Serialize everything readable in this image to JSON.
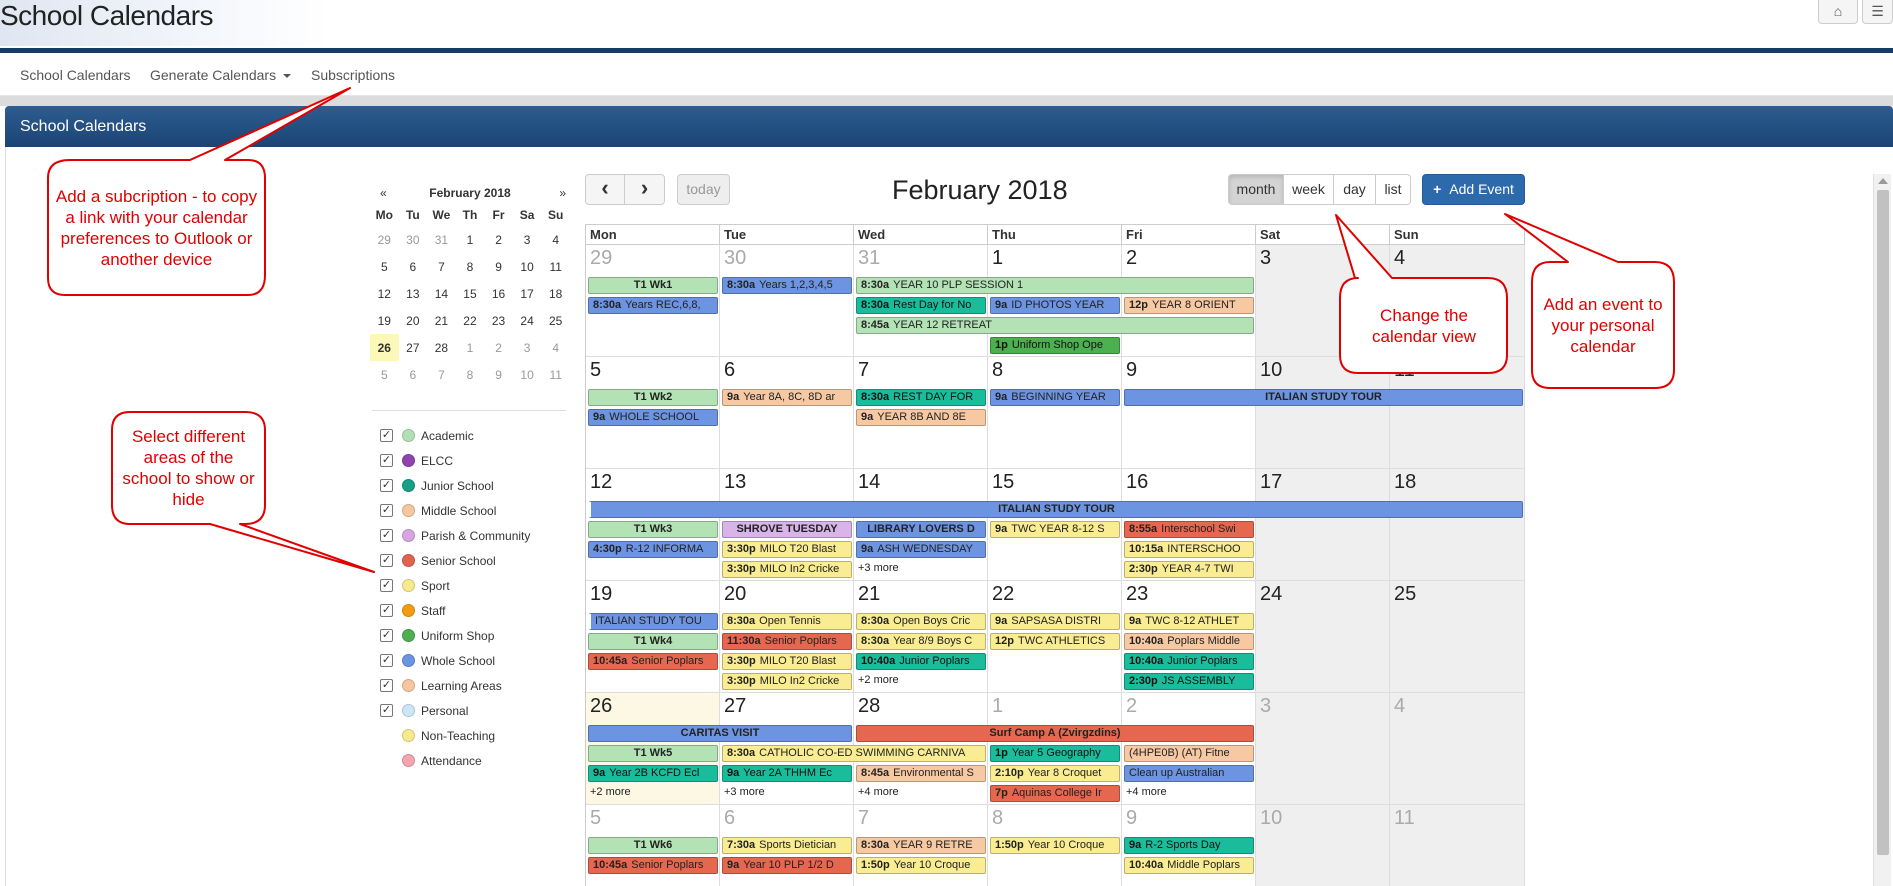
{
  "app": {
    "title": "School Calendars"
  },
  "topbar": {
    "home_icon": "home-icon",
    "menu_icon": "menu-icon"
  },
  "nav": {
    "items": [
      "School Calendars",
      "Generate Calendars",
      "Subscriptions"
    ]
  },
  "panel": {
    "title": "School Calendars"
  },
  "mini_calendar": {
    "prev": "«",
    "next": "»",
    "title": "February 2018",
    "weekdays": [
      "Mo",
      "Tu",
      "We",
      "Th",
      "Fr",
      "Sa",
      "Su"
    ],
    "weeks": [
      [
        "29",
        "30",
        "31",
        "1",
        "2",
        "3",
        "4"
      ],
      [
        "5",
        "6",
        "7",
        "8",
        "9",
        "10",
        "11"
      ],
      [
        "12",
        "13",
        "14",
        "15",
        "16",
        "17",
        "18"
      ],
      [
        "19",
        "20",
        "21",
        "22",
        "23",
        "24",
        "25"
      ],
      [
        "26",
        "27",
        "28",
        "1",
        "2",
        "3",
        "4"
      ],
      [
        "5",
        "6",
        "7",
        "8",
        "9",
        "10",
        "11"
      ]
    ],
    "today": "26"
  },
  "filters": [
    {
      "label": "Academic",
      "color": "#b3e0b3",
      "checked": true
    },
    {
      "label": "ELCC",
      "color": "#8e44ad",
      "checked": true
    },
    {
      "label": "Junior School",
      "color": "#16a085",
      "checked": true
    },
    {
      "label": "Middle School",
      "color": "#f5c6a0",
      "checked": true
    },
    {
      "label": "Parish & Community",
      "color": "#d7a6e0",
      "checked": true
    },
    {
      "label": "Senior School",
      "color": "#e0624f",
      "checked": true
    },
    {
      "label": "Sport",
      "color": "#f7e98e",
      "checked": true
    },
    {
      "label": "Staff",
      "color": "#f39c12",
      "checked": true
    },
    {
      "label": "Uniform Shop",
      "color": "#4caf50",
      "checked": true
    },
    {
      "label": "Whole School",
      "color": "#6d94e0",
      "checked": true
    },
    {
      "label": "Learning Areas",
      "color": "#f5c6a0",
      "checked": true
    },
    {
      "label": "Personal",
      "color": "#cde6f7",
      "checked": true
    },
    {
      "label": "Non-Teaching",
      "color": "#f7e98e",
      "checked": false
    },
    {
      "label": "Attendance",
      "color": "#f4a6b0",
      "checked": false
    }
  ],
  "toolbar": {
    "prev": "‹",
    "next": "›",
    "today": "today",
    "title": "February 2018",
    "views": [
      "month",
      "week",
      "day",
      "list"
    ],
    "active_view": "month",
    "add_event": "Add Event",
    "add_icon": "+"
  },
  "colors": {
    "academic": "#b3e3b5",
    "whole": "#6d94e0",
    "junior": "#1abc9c",
    "middle": "#f7c9a3",
    "sport": "#f9ec92",
    "senior": "#e5674f",
    "parish": "#d8b4e8",
    "uniform": "#4caf50",
    "learning": "#f7c9a3",
    "personal": "#cfe7f9"
  },
  "calendar": {
    "days": [
      "Mon",
      "Tue",
      "Wed",
      "Thu",
      "Fri",
      "Sat",
      "Sun"
    ],
    "weeks": [
      {
        "dates": [
          [
            "29",
            true
          ],
          [
            "30",
            true
          ],
          [
            "31",
            true
          ],
          [
            "1",
            false
          ],
          [
            "2",
            false
          ],
          [
            "3",
            false
          ],
          [
            "4",
            false
          ]
        ],
        "events": [
          {
            "c": 0,
            "s": 1,
            "r": 0,
            "cat": "academic",
            "time": "",
            "title": "T1 Wk1",
            "center": true
          },
          {
            "c": 0,
            "s": 1,
            "r": 1,
            "cat": "whole",
            "time": "8:30a",
            "title": "Years REC,6,8,"
          },
          {
            "c": 1,
            "s": 1,
            "r": 0,
            "cat": "whole",
            "time": "8:30a",
            "title": "Years 1,2,3,4,5"
          },
          {
            "c": 2,
            "s": 3,
            "r": 0,
            "cat": "academic",
            "time": "8:30a",
            "title": "YEAR 10 PLP SESSION 1"
          },
          {
            "c": 2,
            "s": 1,
            "r": 1,
            "cat": "junior",
            "time": "8:30a",
            "title": "Rest Day for No"
          },
          {
            "c": 3,
            "s": 1,
            "r": 1,
            "cat": "whole",
            "time": "9a",
            "title": "ID PHOTOS YEAR"
          },
          {
            "c": 4,
            "s": 1,
            "r": 1,
            "cat": "middle",
            "time": "12p",
            "title": "YEAR 8 ORIENT"
          },
          {
            "c": 2,
            "s": 3,
            "r": 2,
            "cat": "academic",
            "time": "8:45a",
            "title": "YEAR 12 RETREAT"
          },
          {
            "c": 3,
            "s": 1,
            "r": 3,
            "cat": "uniform",
            "time": "1p",
            "title": "Uniform Shop Ope"
          }
        ],
        "more": []
      },
      {
        "dates": [
          [
            "5",
            false
          ],
          [
            "6",
            false
          ],
          [
            "7",
            false
          ],
          [
            "8",
            false
          ],
          [
            "9",
            false
          ],
          [
            "10",
            false
          ],
          [
            "11",
            false
          ]
        ],
        "events": [
          {
            "c": 0,
            "s": 1,
            "r": 0,
            "cat": "academic",
            "time": "",
            "title": "T1 Wk2",
            "center": true
          },
          {
            "c": 0,
            "s": 1,
            "r": 1,
            "cat": "whole",
            "time": "9a",
            "title": "WHOLE SCHOOL"
          },
          {
            "c": 1,
            "s": 1,
            "r": 0,
            "cat": "middle",
            "time": "9a",
            "title": "Year 8A, 8C, 8D ar"
          },
          {
            "c": 2,
            "s": 1,
            "r": 0,
            "cat": "junior",
            "time": "8:30a",
            "title": "REST DAY FOR"
          },
          {
            "c": 2,
            "s": 1,
            "r": 1,
            "cat": "middle",
            "time": "9a",
            "title": "YEAR 8B AND 8E"
          },
          {
            "c": 3,
            "s": 1,
            "r": 0,
            "cat": "whole",
            "time": "9a",
            "title": "BEGINNING YEAR"
          },
          {
            "c": 4,
            "s": 3,
            "r": 0,
            "cat": "whole",
            "time": "",
            "title": "ITALIAN STUDY TOUR",
            "center": true,
            "contR": true
          }
        ],
        "more": []
      },
      {
        "dates": [
          [
            "12",
            false
          ],
          [
            "13",
            false
          ],
          [
            "14",
            false
          ],
          [
            "15",
            false
          ],
          [
            "16",
            false
          ],
          [
            "17",
            false
          ],
          [
            "18",
            false
          ]
        ],
        "events": [
          {
            "c": 0,
            "s": 7,
            "r": 0,
            "cat": "whole",
            "time": "",
            "title": "ITALIAN STUDY TOUR",
            "center": true,
            "contL": true
          },
          {
            "c": 0,
            "s": 1,
            "r": 1,
            "cat": "academic",
            "time": "",
            "title": "T1 Wk3",
            "center": true
          },
          {
            "c": 0,
            "s": 1,
            "r": 2,
            "cat": "whole",
            "time": "4:30p",
            "title": "R-12 INFORMA"
          },
          {
            "c": 1,
            "s": 1,
            "r": 1,
            "cat": "parish",
            "time": "",
            "title": "SHROVE TUESDAY",
            "center": true
          },
          {
            "c": 1,
            "s": 1,
            "r": 2,
            "cat": "sport",
            "time": "3:30p",
            "title": "MILO T20 Blast"
          },
          {
            "c": 1,
            "s": 1,
            "r": 3,
            "cat": "sport",
            "time": "3:30p",
            "title": "MILO In2 Cricke"
          },
          {
            "c": 2,
            "s": 1,
            "r": 1,
            "cat": "whole",
            "time": "",
            "title": "LIBRARY LOVERS D",
            "center": true
          },
          {
            "c": 2,
            "s": 1,
            "r": 2,
            "cat": "whole",
            "time": "9a",
            "title": "ASH WEDNESDAY"
          },
          {
            "c": 3,
            "s": 1,
            "r": 1,
            "cat": "sport",
            "time": "9a",
            "title": "TWC YEAR 8-12 S"
          },
          {
            "c": 4,
            "s": 1,
            "r": 1,
            "cat": "senior",
            "time": "8:55a",
            "title": "Interschool Swi"
          },
          {
            "c": 4,
            "s": 1,
            "r": 2,
            "cat": "sport",
            "time": "10:15a",
            "title": "INTERSCHOO"
          },
          {
            "c": 4,
            "s": 1,
            "r": 3,
            "cat": "sport",
            "time": "2:30p",
            "title": "YEAR 4-7 TWI"
          }
        ],
        "more": [
          {
            "c": 2,
            "r": 3,
            "text": "+3 more"
          }
        ]
      },
      {
        "dates": [
          [
            "19",
            false
          ],
          [
            "20",
            false
          ],
          [
            "21",
            false
          ],
          [
            "22",
            false
          ],
          [
            "23",
            false
          ],
          [
            "24",
            false
          ],
          [
            "25",
            false
          ]
        ],
        "events": [
          {
            "c": 0,
            "s": 1,
            "r": 0,
            "cat": "whole",
            "time": "",
            "title": "ITALIAN STUDY TOU",
            "contL": true
          },
          {
            "c": 0,
            "s": 1,
            "r": 1,
            "cat": "academic",
            "time": "",
            "title": "T1 Wk4",
            "center": true
          },
          {
            "c": 0,
            "s": 1,
            "r": 2,
            "cat": "senior",
            "time": "10:45a",
            "title": "Senior Poplars"
          },
          {
            "c": 1,
            "s": 1,
            "r": 0,
            "cat": "sport",
            "time": "8:30a",
            "title": "Open Tennis"
          },
          {
            "c": 1,
            "s": 1,
            "r": 1,
            "cat": "senior",
            "time": "11:30a",
            "title": "Senior Poplars"
          },
          {
            "c": 1,
            "s": 1,
            "r": 2,
            "cat": "sport",
            "time": "3:30p",
            "title": "MILO T20 Blast"
          },
          {
            "c": 1,
            "s": 1,
            "r": 3,
            "cat": "sport",
            "time": "3:30p",
            "title": "MILO In2 Cricke"
          },
          {
            "c": 2,
            "s": 1,
            "r": 0,
            "cat": "sport",
            "time": "8:30a",
            "title": "Open Boys Cric"
          },
          {
            "c": 2,
            "s": 1,
            "r": 1,
            "cat": "sport",
            "time": "8:30a",
            "title": "Year 8/9 Boys C"
          },
          {
            "c": 2,
            "s": 1,
            "r": 2,
            "cat": "junior",
            "time": "10:40a",
            "title": "Junior Poplars"
          },
          {
            "c": 3,
            "s": 1,
            "r": 0,
            "cat": "sport",
            "time": "9a",
            "title": "SAPSASA DISTRI"
          },
          {
            "c": 3,
            "s": 1,
            "r": 1,
            "cat": "sport",
            "time": "12p",
            "title": "TWC ATHLETICS"
          },
          {
            "c": 4,
            "s": 1,
            "r": 0,
            "cat": "sport",
            "time": "9a",
            "title": "TWC 8-12 ATHLET"
          },
          {
            "c": 4,
            "s": 1,
            "r": 1,
            "cat": "middle",
            "time": "10:40a",
            "title": "Poplars Middle"
          },
          {
            "c": 4,
            "s": 1,
            "r": 2,
            "cat": "junior",
            "time": "10:40a",
            "title": "Junior Poplars"
          },
          {
            "c": 4,
            "s": 1,
            "r": 3,
            "cat": "junior",
            "time": "2:30p",
            "title": "JS ASSEMBLY"
          }
        ],
        "more": [
          {
            "c": 2,
            "r": 3,
            "text": "+2 more"
          }
        ]
      },
      {
        "dates": [
          [
            "26",
            false
          ],
          [
            "27",
            false
          ],
          [
            "28",
            false
          ],
          [
            "1",
            true
          ],
          [
            "2",
            true
          ],
          [
            "3",
            true
          ],
          [
            "4",
            true
          ]
        ],
        "events": [
          {
            "c": 0,
            "s": 2,
            "r": 0,
            "cat": "whole",
            "time": "",
            "title": "CARITAS VISIT",
            "center": true
          },
          {
            "c": 2,
            "s": 3,
            "r": 0,
            "cat": "senior",
            "time": "",
            "title": "Surf Camp A (Zvirgzdins)",
            "center": true
          },
          {
            "c": 0,
            "s": 1,
            "r": 1,
            "cat": "academic",
            "time": "",
            "title": "T1 Wk5",
            "center": true
          },
          {
            "c": 0,
            "s": 1,
            "r": 2,
            "cat": "junior",
            "time": "9a",
            "title": "Year 2B KCFD Ecl"
          },
          {
            "c": 1,
            "s": 2,
            "r": 1,
            "cat": "sport",
            "time": "8:30a",
            "title": "CATHOLIC CO-ED SWIMMING CARNIVA"
          },
          {
            "c": 1,
            "s": 1,
            "r": 2,
            "cat": "junior",
            "time": "9a",
            "title": "Year 2A THHM Ec"
          },
          {
            "c": 2,
            "s": 1,
            "r": 2,
            "cat": "middle",
            "time": "8:45a",
            "title": "Environmental S"
          },
          {
            "c": 3,
            "s": 1,
            "r": 1,
            "cat": "junior",
            "time": "1p",
            "title": "Year 5 Geography"
          },
          {
            "c": 3,
            "s": 1,
            "r": 2,
            "cat": "sport",
            "time": "2:10p",
            "title": "Year 8 Croquet"
          },
          {
            "c": 3,
            "s": 1,
            "r": 3,
            "cat": "senior",
            "time": "7p",
            "title": "Aquinas College Ir"
          },
          {
            "c": 4,
            "s": 1,
            "r": 1,
            "cat": "learning",
            "time": "",
            "title": "(4HPE0B) (AT) Fitne"
          },
          {
            "c": 4,
            "s": 1,
            "r": 2,
            "cat": "whole",
            "time": "",
            "title": "Clean up Australian"
          }
        ],
        "more": [
          {
            "c": 0,
            "r": 3,
            "text": "+2 more"
          },
          {
            "c": 1,
            "r": 3,
            "text": "+3 more"
          },
          {
            "c": 2,
            "r": 3,
            "text": "+4 more"
          },
          {
            "c": 4,
            "r": 3,
            "text": "+4 more"
          }
        ]
      },
      {
        "dates": [
          [
            "5",
            true
          ],
          [
            "6",
            true
          ],
          [
            "7",
            true
          ],
          [
            "8",
            true
          ],
          [
            "9",
            true
          ],
          [
            "10",
            true
          ],
          [
            "11",
            true
          ]
        ],
        "events": [
          {
            "c": 0,
            "s": 1,
            "r": 0,
            "cat": "academic",
            "time": "",
            "title": "T1 Wk6",
            "center": true
          },
          {
            "c": 0,
            "s": 1,
            "r": 1,
            "cat": "senior",
            "time": "10:45a",
            "title": "Senior Poplars"
          },
          {
            "c": 1,
            "s": 1,
            "r": 0,
            "cat": "sport",
            "time": "7:30a",
            "title": "Sports Dietician"
          },
          {
            "c": 1,
            "s": 1,
            "r": 1,
            "cat": "senior",
            "time": "9a",
            "title": "Year 10 PLP 1/2 D"
          },
          {
            "c": 2,
            "s": 1,
            "r": 0,
            "cat": "middle",
            "time": "8:30a",
            "title": "YEAR 9 RETRE"
          },
          {
            "c": 2,
            "s": 1,
            "r": 1,
            "cat": "sport",
            "time": "1:50p",
            "title": "Year 10 Croque"
          },
          {
            "c": 3,
            "s": 1,
            "r": 0,
            "cat": "sport",
            "time": "1:50p",
            "title": "Year 10 Croque"
          },
          {
            "c": 4,
            "s": 1,
            "r": 0,
            "cat": "junior",
            "time": "9a",
            "title": "R-2 Sports Day"
          },
          {
            "c": 4,
            "s": 1,
            "r": 1,
            "cat": "sport",
            "time": "10:40a",
            "title": "Middle Poplars"
          }
        ],
        "more": []
      }
    ]
  },
  "callouts": {
    "subscription": "Add a subcription - to copy a link with your calendar preferences to Outlook or another device",
    "filters": "Select different areas of the school to show or hide",
    "view": "Change the calendar view",
    "add": "Add an event to your personal calendar"
  }
}
